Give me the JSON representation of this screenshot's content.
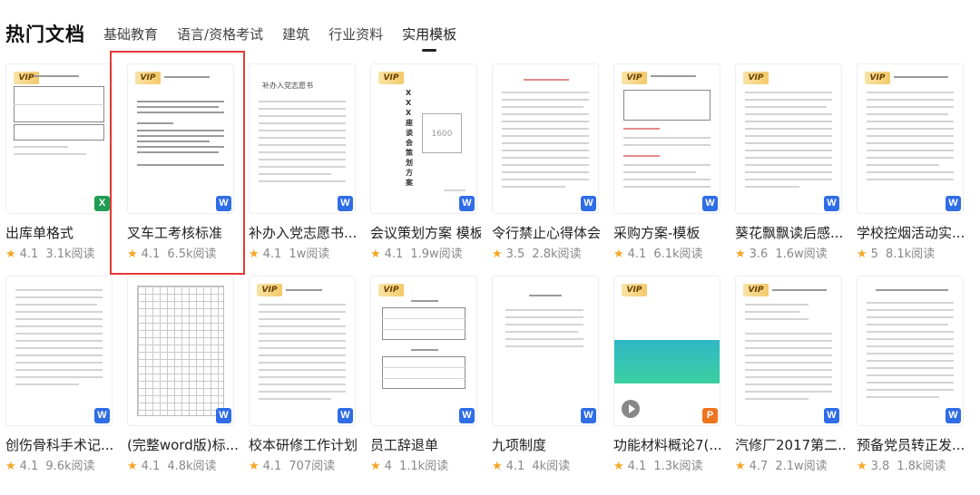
{
  "page_title": "热门文档",
  "tabs": [
    {
      "label": "基础教育"
    },
    {
      "label": "语言/资格考试"
    },
    {
      "label": "建筑"
    },
    {
      "label": "行业资料"
    },
    {
      "label": "实用模板"
    }
  ],
  "active_tab": "实用模板",
  "vip_label": "VIP",
  "thumb_texts": {
    "d3_heading": "补办入党志愿书",
    "d4_title": "XXX座谈会策划方案",
    "d4_box": "1600"
  },
  "documents": [
    {
      "title": "出库单格式",
      "rating": "4.1",
      "reads": "3.1k阅读",
      "file_type": "X",
      "vip": true
    },
    {
      "title": "叉车工考核标准",
      "rating": "4.1",
      "reads": "6.5k阅读",
      "file_type": "W",
      "vip": true,
      "highlighted": true
    },
    {
      "title": "补办入党志愿书...",
      "rating": "4.1",
      "reads": "1w阅读",
      "file_type": "W",
      "vip": false
    },
    {
      "title": "会议策划方案 模板",
      "rating": "4.1",
      "reads": "1.9w阅读",
      "file_type": "W",
      "vip": true
    },
    {
      "title": "令行禁止心得体会",
      "rating": "3.5",
      "reads": "2.8k阅读",
      "file_type": "W",
      "vip": false
    },
    {
      "title": "采购方案-模板",
      "rating": "4.1",
      "reads": "6.1k阅读",
      "file_type": "W",
      "vip": true
    },
    {
      "title": "葵花飘飘读后感...",
      "rating": "3.6",
      "reads": "1.6w阅读",
      "file_type": "W",
      "vip": true
    },
    {
      "title": "学校控烟活动实...",
      "rating": "5",
      "reads": "8.1k阅读",
      "file_type": "W",
      "vip": true
    },
    {
      "title": "创伤骨科手术记...",
      "rating": "4.1",
      "reads": "9.6k阅读",
      "file_type": "W",
      "vip": false
    },
    {
      "title": "(完整word版)标...",
      "rating": "4.1",
      "reads": "4.8k阅读",
      "file_type": "W",
      "vip": false
    },
    {
      "title": "校本研修工作计划",
      "rating": "4.1",
      "reads": "707阅读",
      "file_type": "W",
      "vip": true
    },
    {
      "title": "员工辞退单",
      "rating": "4",
      "reads": "1.1k阅读",
      "file_type": "W",
      "vip": true
    },
    {
      "title": "九项制度",
      "rating": "4.1",
      "reads": "4k阅读",
      "file_type": "W",
      "vip": false
    },
    {
      "title": "功能材料概论7(...",
      "rating": "4.1",
      "reads": "1.3k阅读",
      "file_type": "P",
      "vip": true
    },
    {
      "title": "汽修厂2017第二...",
      "rating": "4.7",
      "reads": "2.1w阅读",
      "file_type": "W",
      "vip": true
    },
    {
      "title": "预备党员转正发...",
      "rating": "3.8",
      "reads": "1.8k阅读",
      "file_type": "W",
      "vip": false
    }
  ],
  "colors": {
    "star": "#f5a623",
    "highlight_border": "#e53935",
    "word_icon": "#2f6de6",
    "excel_icon": "#1f9d55",
    "ppt_icon": "#f0741f",
    "vip_badge": "#f3c96a"
  }
}
